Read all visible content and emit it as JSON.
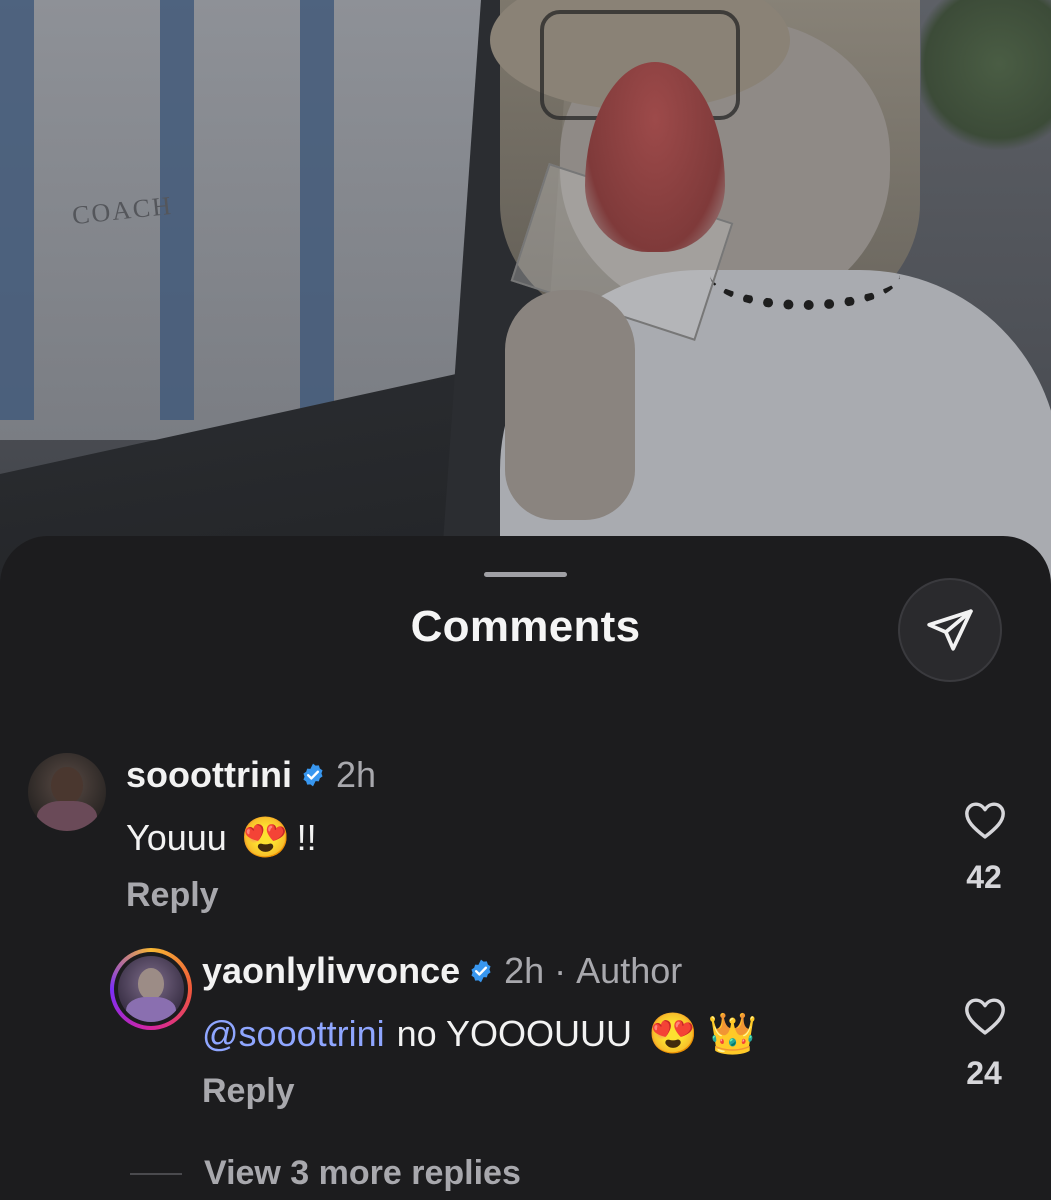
{
  "photo": {
    "sign_text": "COACH"
  },
  "sheet": {
    "title": "Comments"
  },
  "comments": [
    {
      "username": "sooottrini",
      "time": "2h",
      "text_prefix": "Youuu",
      "emoji": "😍",
      "text_suffix": "!!",
      "reply_label": "Reply",
      "likes": "42"
    }
  ],
  "reply": {
    "username": "yaonlylivvonce",
    "time": "2h",
    "separator": "·",
    "author_label": "Author",
    "mention": "@sooottrini",
    "text": "no YOOOUUU",
    "emoji1": "😍",
    "emoji2": "👑",
    "reply_label": "Reply",
    "likes": "24"
  },
  "view_more": {
    "label": "View 3 more replies"
  },
  "colors": {
    "background": "#1c1c1e",
    "verified": "#3897f0",
    "mention": "#8fa6ff",
    "secondary_text": "#a8a8ad"
  }
}
